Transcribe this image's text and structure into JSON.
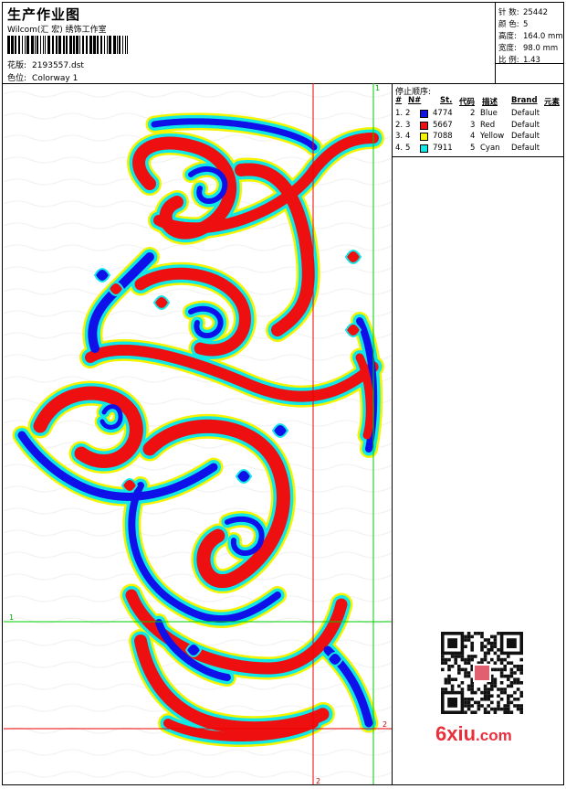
{
  "header": {
    "title": "生产作业图",
    "company": "Wilcom(汇 宏) 绣饰工作室",
    "design_label": "花版:",
    "design_value": "2193557.dst",
    "colorway_label": "色位:",
    "colorway_value": "Colorway 1"
  },
  "stats": {
    "stitches_label": "针 数:",
    "stitches_value": "25442",
    "colors_label": "颜 色:",
    "colors_value": "5",
    "height_label": "高度:",
    "height_value": "164.0 mm",
    "width_label": "宽度:",
    "width_value": "98.0 mm",
    "ratio_label": "比 例:",
    "ratio_value": "1.43"
  },
  "stop_sequence": {
    "title": "停止顺序:",
    "headers": [
      "#",
      "N#",
      "St.",
      "代码",
      "描述",
      "Brand",
      "元素"
    ],
    "rows": [
      {
        "idx": "1.",
        "n": "2",
        "code": "4774",
        "st": "2",
        "desc": "Blue",
        "brand": "Default",
        "color": "#1010e8"
      },
      {
        "idx": "2.",
        "n": "3",
        "code": "5667",
        "st": "3",
        "desc": "Red",
        "brand": "Default",
        "color": "#ee1010"
      },
      {
        "idx": "3.",
        "n": "4",
        "code": "7088",
        "st": "4",
        "desc": "Yellow",
        "brand": "Default",
        "color": "#f4f400"
      },
      {
        "idx": "4.",
        "n": "5",
        "code": "7911",
        "st": "5",
        "desc": "Cyan",
        "brand": "Default",
        "color": "#10e8e8"
      }
    ]
  },
  "canvas": {
    "marker_1_top": "1",
    "marker_1_left": "1",
    "marker_2_right": "2",
    "marker_2_bottom": "2",
    "guide_green": "#00cc00",
    "guide_red": "#ee0000"
  },
  "watermark": {
    "domain": "6xiu",
    "tld": ".com"
  }
}
